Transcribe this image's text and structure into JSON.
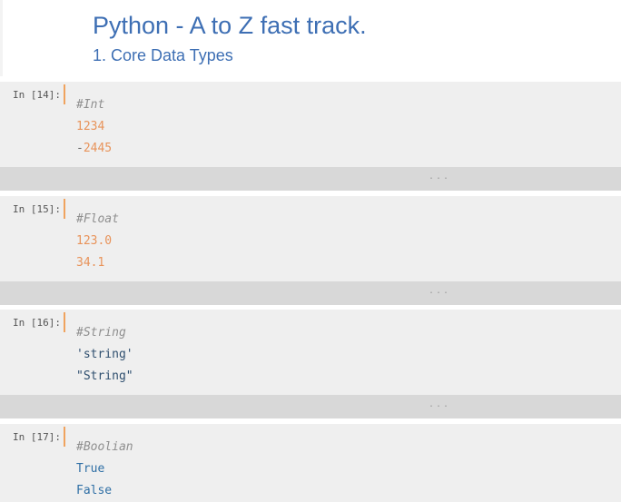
{
  "header": {
    "title": "Python - A to Z fast track.",
    "subtitle": "1. Core Data Types"
  },
  "cells": [
    {
      "prompt": "In [14]:",
      "comment": "#Int",
      "line1": "1234",
      "line2_sign": "-",
      "line2": "2445",
      "output": "..."
    },
    {
      "prompt": "In [15]:",
      "comment": "#Float",
      "line1": "123.0",
      "line2": "34.1",
      "output": "..."
    },
    {
      "prompt": "In [16]:",
      "comment": "#String",
      "line1": "'string'",
      "line2": "\"String\"",
      "output": "..."
    },
    {
      "prompt": "In [17]:",
      "comment": "#Boolian",
      "line1": "True",
      "line2": "False"
    }
  ],
  "colors": {
    "title": "#3e6fb4",
    "number": "#e8935a",
    "comment": "#8f8f8f",
    "string": "#2f4f6f",
    "keyword": "#2f6fa5",
    "prompt_bar": "#f0a35e"
  }
}
